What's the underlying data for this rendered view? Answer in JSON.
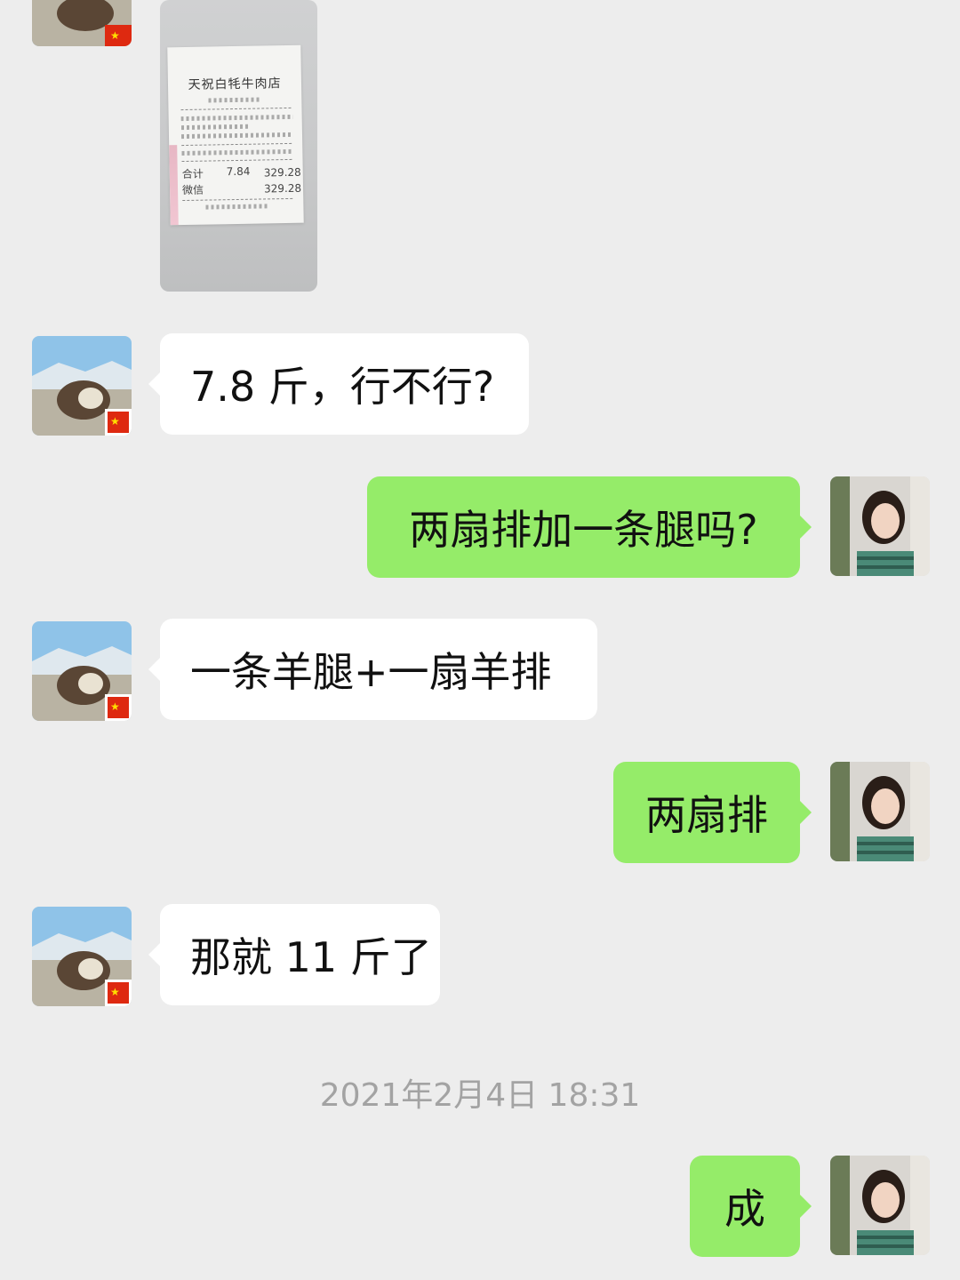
{
  "messages": [
    {
      "sender": "other",
      "type": "image",
      "content": "receipt photo",
      "receipt": {
        "store_name": "天祝白牦牛肉店",
        "total_label": "合计",
        "total_qty": "7.84",
        "total_amount": "329.28",
        "paid_label": "微信",
        "paid_amount": "329.28"
      }
    },
    {
      "sender": "other",
      "type": "text",
      "text": "7.8 斤，行不行?"
    },
    {
      "sender": "me",
      "type": "text",
      "text": "两扇排加一条腿吗?"
    },
    {
      "sender": "other",
      "type": "text",
      "text": "一条羊腿+一扇羊排"
    },
    {
      "sender": "me",
      "type": "text",
      "text": "两扇排"
    },
    {
      "sender": "other",
      "type": "text",
      "text": "那就 11 斤了"
    },
    {
      "type": "timestamp",
      "text": "2021年2月4日 18:31"
    },
    {
      "sender": "me",
      "type": "text",
      "text": "成"
    }
  ],
  "colors": {
    "background": "#ededed",
    "incoming_bubble": "#ffffff",
    "outgoing_bubble": "#95ec69",
    "timestamp_text": "#a3a3a3"
  },
  "icons": {
    "other_avatar": "yak-photo-avatar-with-china-flag",
    "my_avatar": "woman-portrait-avatar"
  }
}
